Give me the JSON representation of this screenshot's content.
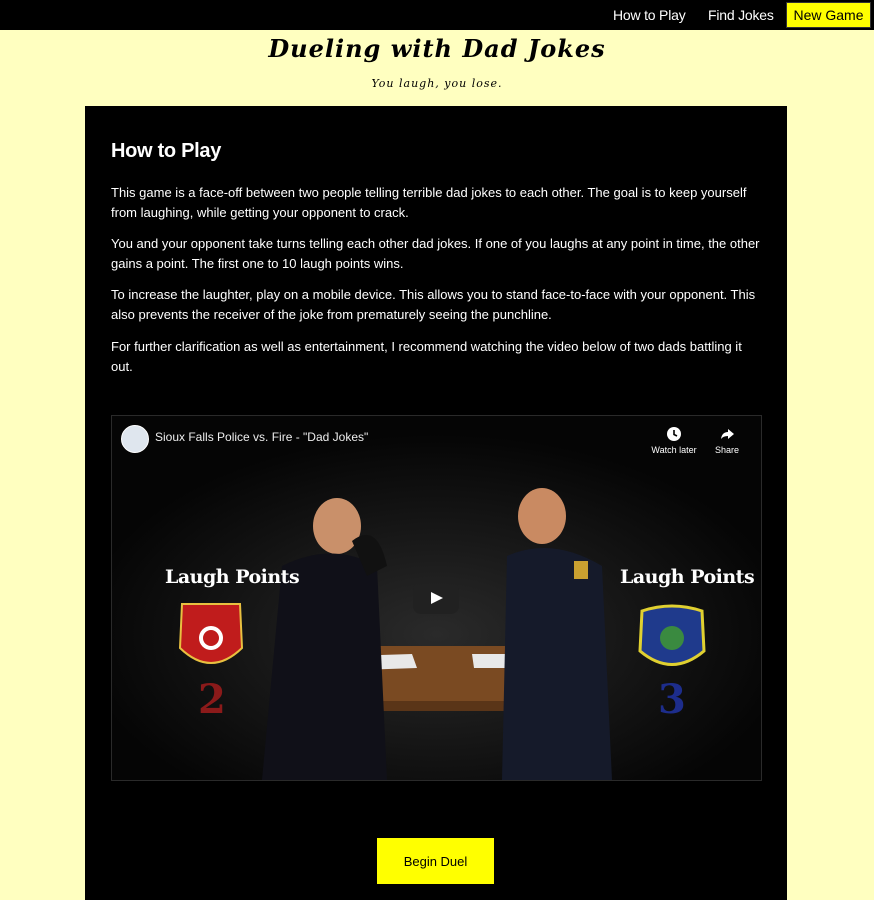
{
  "nav": {
    "how_to_play": "How to Play",
    "find_jokes": "Find Jokes",
    "new_game": "New Game"
  },
  "header": {
    "title": "Dueling with Dad Jokes",
    "tagline": "You laugh, you lose."
  },
  "main": {
    "heading": "How to Play",
    "paragraphs": [
      "This game is a face-off between two people telling terrible dad jokes to each other. The goal is to keep yourself from laughing, while getting your opponent to crack.",
      "You and your opponent take turns telling each other dad jokes. If one of you laughs at any point in time, the other gains a point. The first one to 10 laugh points wins.",
      "To increase the laughter, play on a mobile device. This allows you to stand face-to-face with your opponent. This also prevents the receiver of the joke from prematurely seeing the punchline.",
      "For further clarification as well as entertainment, I recommend watching the video below of two dads battling it out."
    ],
    "video": {
      "title": "Sioux Falls Police vs. Fire - \"Dad Jokes\"",
      "watch_later": "Watch later",
      "share": "Share",
      "left_label": "Laugh Points",
      "left_score": "2",
      "right_label": "Laugh Points",
      "right_score": "3"
    },
    "begin_button": "Begin Duel"
  },
  "colors": {
    "page_bg": "#ffffc0",
    "accent": "#ffff00",
    "panel_bg": "#000000"
  },
  "icons": [
    "channel-avatar",
    "clock-icon",
    "share-icon",
    "play-icon",
    "fire-badge",
    "police-badge"
  ]
}
